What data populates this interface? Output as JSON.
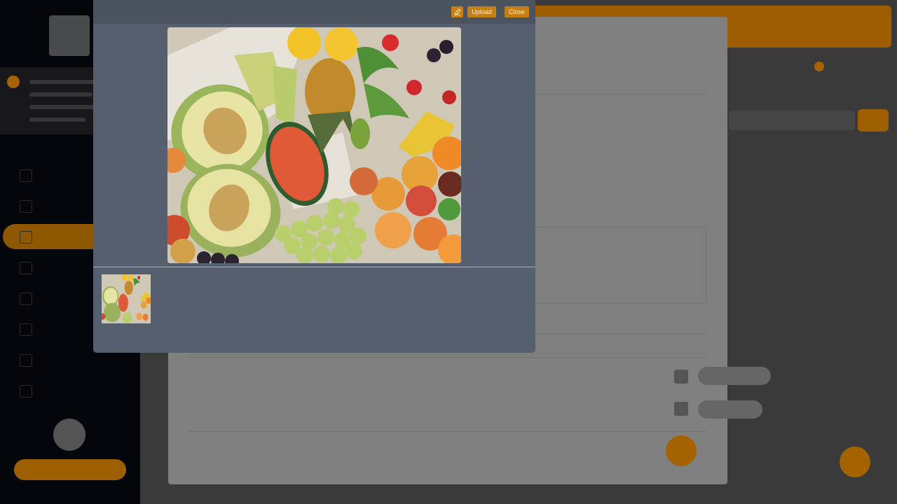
{
  "viewer": {
    "upload_label": "Upload",
    "close_label": "Close",
    "edit_icon": "pencil-icon"
  },
  "background": {
    "sidebar_items": [
      "",
      "",
      "",
      "",
      "",
      "",
      "",
      ""
    ],
    "colors": {
      "accent": "#b06a00",
      "sidebar": "#04070c",
      "panel": "#888888",
      "viewer": "#555f6e",
      "button": "#c47f16"
    }
  }
}
